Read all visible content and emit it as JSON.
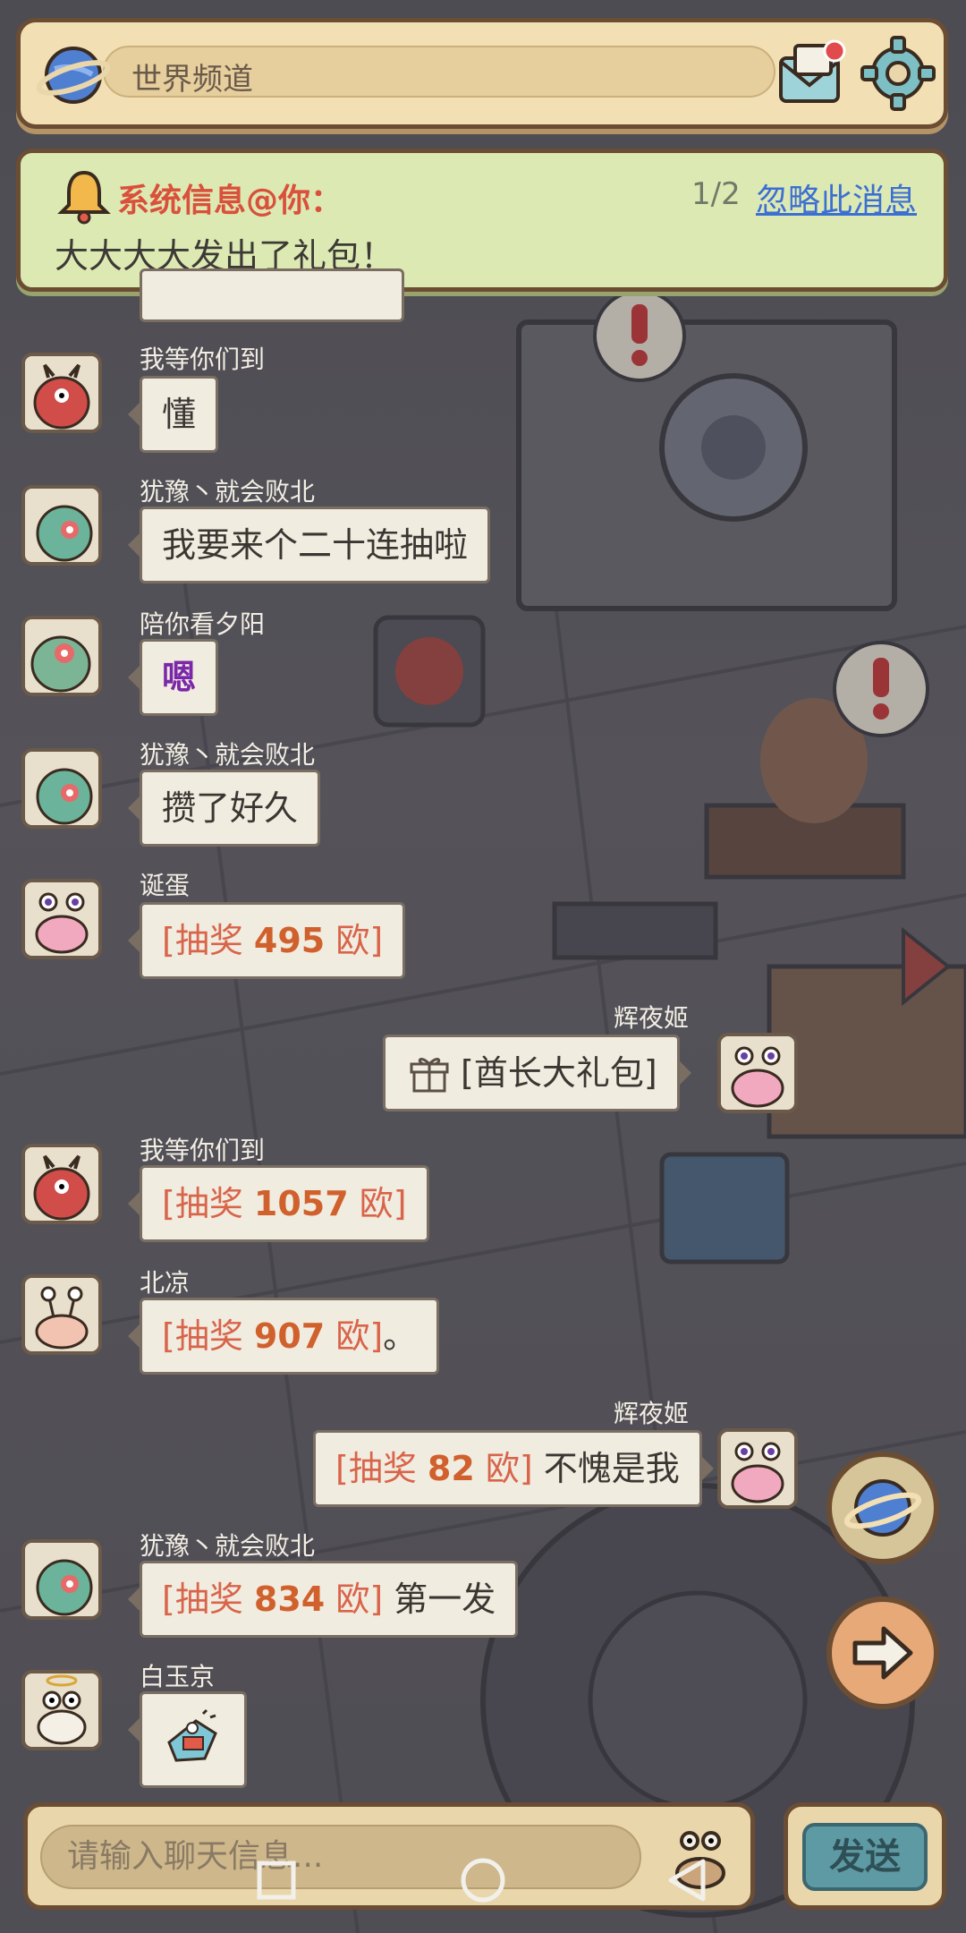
{
  "header": {
    "channel_label": "世界频道"
  },
  "notice": {
    "title": "系统信息@你：",
    "count": "1/2",
    "ignore_label": "忽略此消息",
    "body": "大大大大发出了礼包！"
  },
  "messages": [
    {
      "user": "我等你们到",
      "text": "懂"
    },
    {
      "user": "犹豫丶就会败北",
      "text": "我要来个二十连抽啦"
    },
    {
      "user": "陪你看夕阳",
      "text": "嗯"
    },
    {
      "user": "犹豫丶就会败北",
      "text": "攒了好久"
    },
    {
      "user": "诞蛋",
      "prefix": "[抽奖 ",
      "num": "495",
      "suffix": " 欧]",
      "text": ""
    },
    {
      "user": "辉夜姬",
      "text": "[酋长大礼包]"
    },
    {
      "user": "我等你们到",
      "prefix": "[抽奖 ",
      "num": "1057",
      "suffix": " 欧]",
      "text": ""
    },
    {
      "user": "北凉",
      "prefix": "[抽奖 ",
      "num": "907",
      "suffix": " 欧]",
      "text": "。"
    },
    {
      "user": "辉夜姬",
      "prefix": "[抽奖 ",
      "num": "82",
      "suffix": " 欧]",
      "text": " 不愧是我"
    },
    {
      "user": "犹豫丶就会败北",
      "prefix": "[抽奖 ",
      "num": "834",
      "suffix": " 欧]",
      "text": " 第一发"
    },
    {
      "user": "白玉京",
      "text": ""
    }
  ],
  "input": {
    "placeholder": "请输入聊天信息..."
  },
  "send_label": "发送",
  "colors": {
    "accent_red": "#d9503b",
    "link_blue": "#3b6fd3",
    "lottery_orange": "#d0612d"
  }
}
